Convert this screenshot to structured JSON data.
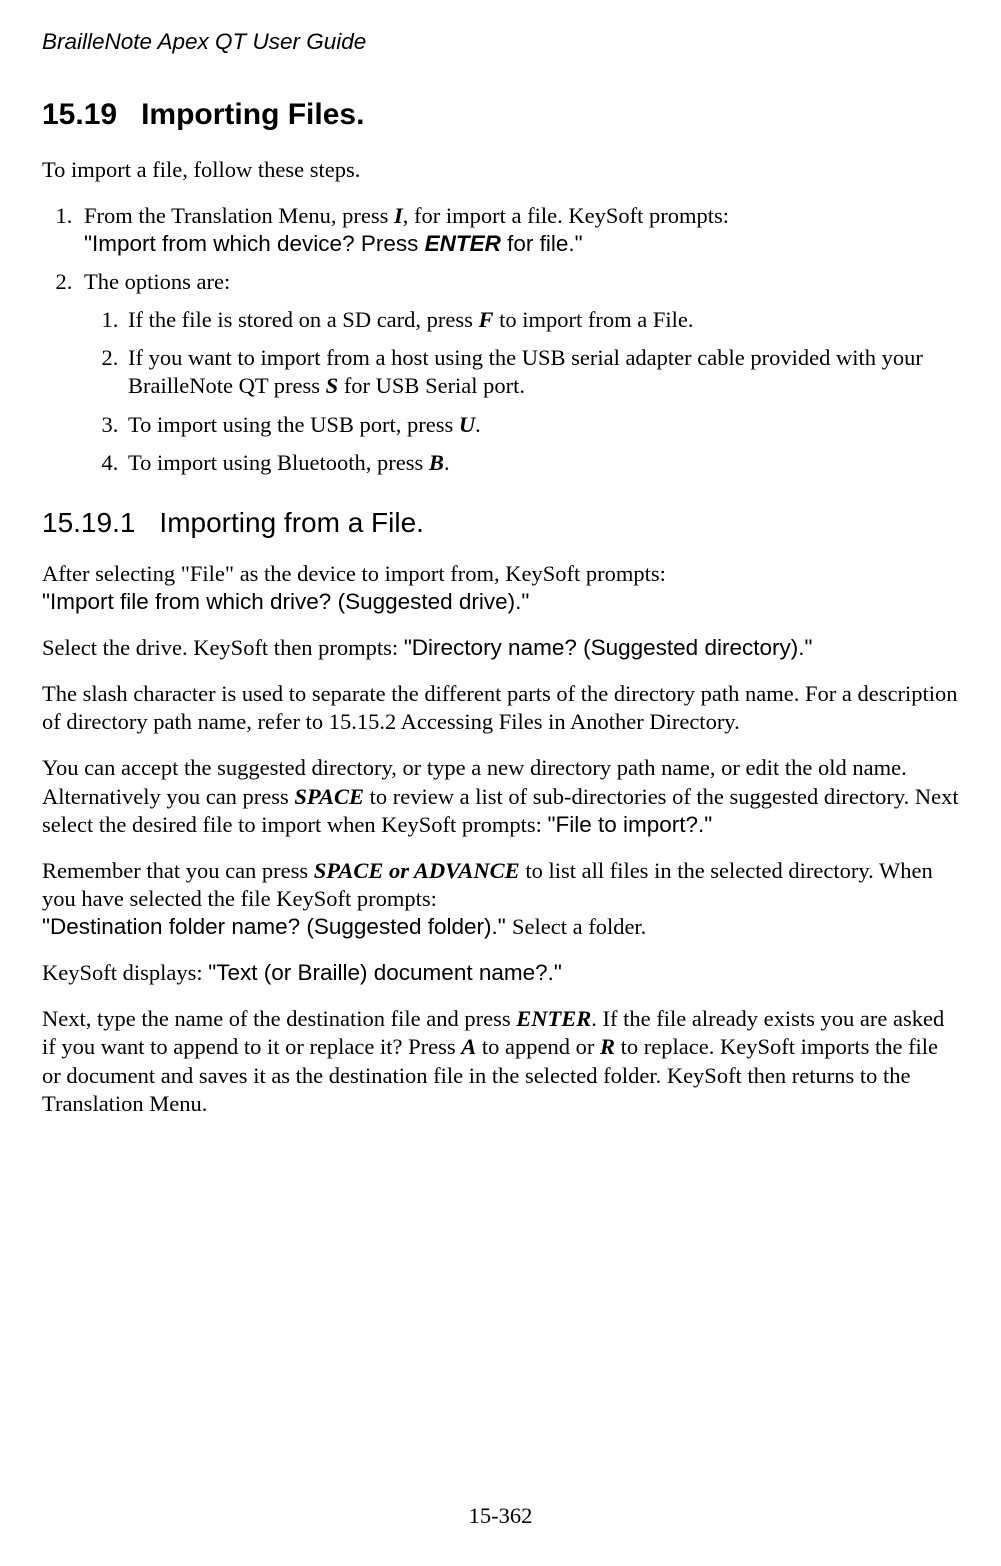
{
  "header": {
    "title": "BrailleNote Apex QT User Guide"
  },
  "section": {
    "number": "15.19",
    "title": "Importing Files."
  },
  "intro": "To import a file, follow these steps.",
  "step1": {
    "pre": "From the Translation Menu, press ",
    "key": "I",
    "post": ", for import a file. KeySoft prompts:",
    "prompt_pre": "\"Import from which device? Press ",
    "prompt_key": "ENTER",
    "prompt_post": " for file.\""
  },
  "step2": {
    "lead": "The options are:",
    "o1_pre": "If the file is stored on a SD card, press ",
    "o1_key": "F",
    "o1_post": " to import from a File.",
    "o2_pre": "If you want to import from a host using the USB serial adapter cable provided with your BrailleNote QT press ",
    "o2_key": "S",
    "o2_post": " for USB Serial port.",
    "o3_pre": "To import using the USB port, press ",
    "o3_key": "U",
    "o3_post": ".",
    "o4_pre": "To import using Bluetooth, press ",
    "o4_key": "B",
    "o4_post": "."
  },
  "subsection": {
    "number": "15.19.1",
    "title": "Importing from a File."
  },
  "p1_line1": "After selecting \"File\" as the device to import from, KeySoft prompts:",
  "p1_prompt": "\"Import file from which drive? (Suggested drive).\"",
  "p2_pre": "Select the drive. KeySoft then prompts: ",
  "p2_prompt": "\"Directory name? (Suggested directory).\"",
  "p3": "The slash character is used to separate the different parts of the directory path name. For a description of directory path name, refer to 15.15.2 Accessing Files in Another Directory.",
  "p4_a": "You can accept the suggested directory, or type a new directory path name, or edit the old name. Alternatively you can press ",
  "p4_key": "SPACE",
  "p4_b": " to review a list of sub-directories of the suggested directory. Next select the desired file to import when KeySoft prompts: ",
  "p4_prompt": "\"File to import?.\"",
  "p5_a": "Remember that you can press ",
  "p5_key": "SPACE or ADVANCE",
  "p5_b": " to list all files in the selected directory. When you have selected the file KeySoft prompts:",
  "p5_prompt": "\"Destination folder name? (Suggested folder).\" ",
  "p5_c": "Select a folder.",
  "p6_a": "KeySoft displays: ",
  "p6_prompt": "\"Text (or Braille) document name?.\"",
  "p7_a": "Next, type the name of the destination file and press ",
  "p7_key1": "ENTER",
  "p7_b": ". If the file already exists you are asked if you want to append to it or replace it? Press ",
  "p7_key2": "A",
  "p7_c": " to append or ",
  "p7_key3": "R",
  "p7_d": " to replace. KeySoft imports the file or document and saves it as the destination file in the selected folder. KeySoft then returns to the Translation Menu.",
  "footer": "15-362"
}
